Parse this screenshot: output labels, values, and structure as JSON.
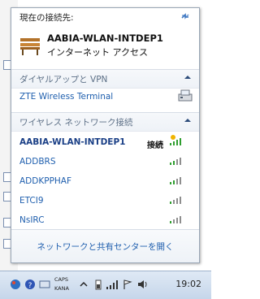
{
  "popup": {
    "current_label": "現在の接続先:",
    "connected_network": {
      "name": "AABIA-WLAN-INTDEP1",
      "type": "インターネット アクセス"
    }
  },
  "sections": {
    "dialup": {
      "title": "ダイヤルアップと VPN",
      "items": [
        "ZTE Wireless Terminal"
      ]
    },
    "wireless": {
      "title": "ワイヤレス ネットワーク接続"
    }
  },
  "networks": [
    {
      "name": "AABIA-WLAN-INTDEP1",
      "status": "接続",
      "connected": true
    },
    {
      "name": "ADDBRS",
      "status": "",
      "connected": false
    },
    {
      "name": "ADDKPPHAF",
      "status": "",
      "connected": false
    },
    {
      "name": "ETCI9",
      "status": "",
      "connected": false
    },
    {
      "name": "NsIRC",
      "status": "",
      "connected": false
    }
  ],
  "footer": {
    "link": "ネットワークと共有センターを開く"
  },
  "taskbar": {
    "caps": "CAPS",
    "kana": "KANA",
    "clock": "19:02"
  },
  "colors": {
    "link_blue": "#1f5fae",
    "signal_green": "#2f9e2f"
  }
}
